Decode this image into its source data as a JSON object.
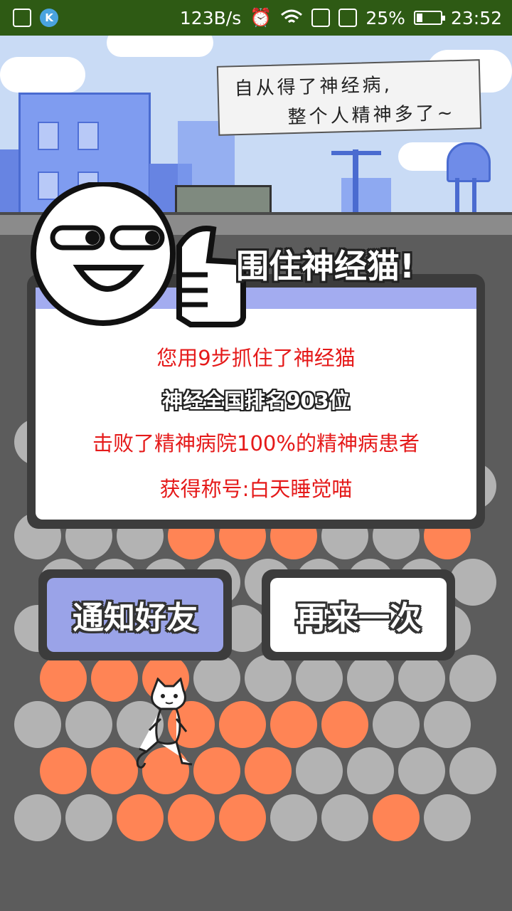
{
  "status_bar": {
    "speed": "123B/s",
    "battery_percent": "25%",
    "battery_level": 0.25,
    "time": "23:52",
    "icons": [
      "image-icon",
      "k-app-icon",
      "alarm-icon",
      "wifi-icon",
      "sim1-icon",
      "sim2-icon",
      "battery-charging-icon"
    ]
  },
  "banner": {
    "line1": "自从得了神经病,",
    "line2": "整个人精神多了~"
  },
  "dialog": {
    "title": "围住神经猫!",
    "line1": "您用9步抓住了神经猫",
    "line2": "神经全国排名903位",
    "line3": "击败了精神病院100%的精神病患者",
    "line4": "获得称号:白天睡觉喵"
  },
  "buttons": {
    "notify": "通知好友",
    "retry": "再来一次"
  },
  "colors": {
    "blocked": "#ff8455",
    "empty": "#b3b3b3",
    "accent": "#a3acf0"
  }
}
